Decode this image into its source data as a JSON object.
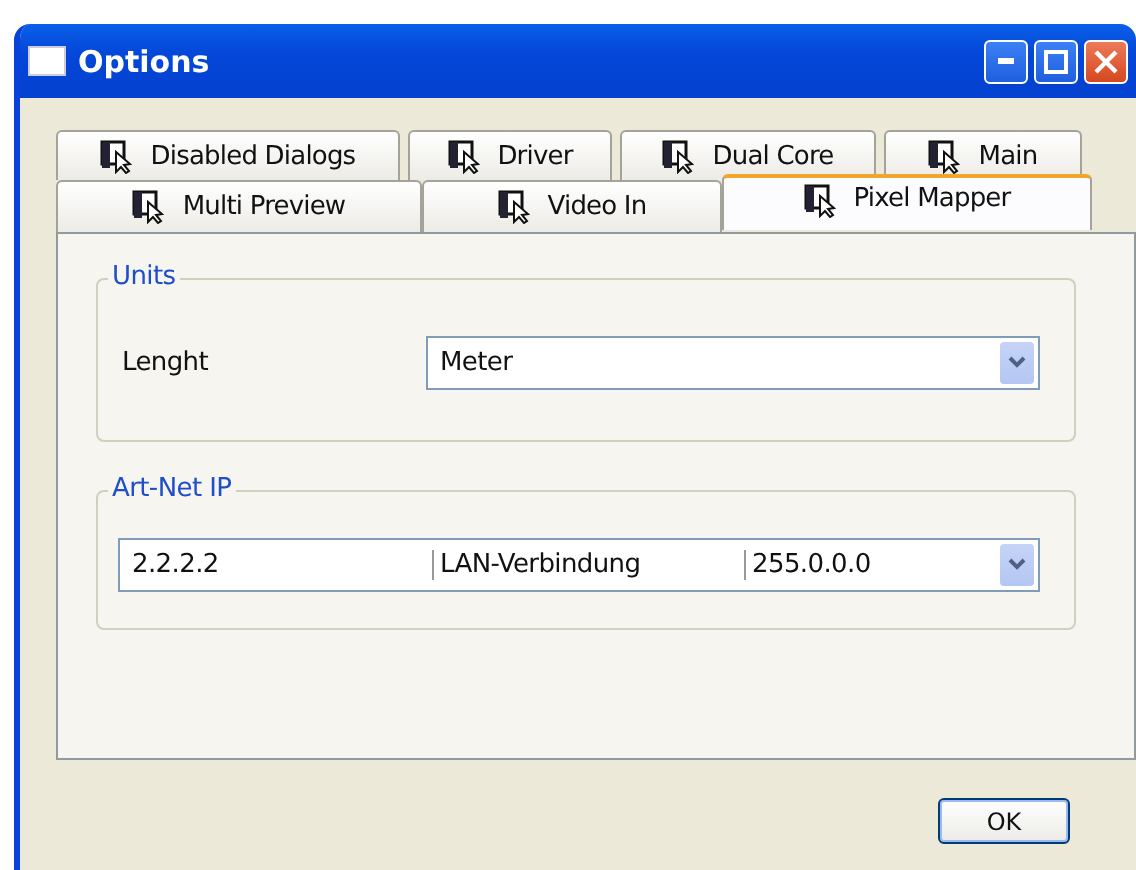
{
  "window": {
    "title": "Options"
  },
  "tabs": {
    "rows": [
      [
        {
          "label": "Disabled Dialogs",
          "selected": false
        },
        {
          "label": "Driver",
          "selected": false
        },
        {
          "label": "Dual Core",
          "selected": false
        },
        {
          "label": "Main",
          "selected": false
        }
      ],
      [
        {
          "label": "Multi Preview",
          "selected": false
        },
        {
          "label": "Video In",
          "selected": false
        },
        {
          "label": "Pixel Mapper",
          "selected": true
        }
      ]
    ]
  },
  "groups": [
    {
      "title": "Units",
      "kind": "field",
      "label": "Lenght",
      "value": "Meter"
    },
    {
      "title": "Art-Net IP",
      "kind": "multi",
      "cells": [
        "2.2.2.2",
        "LAN-Verbindung",
        "255.0.0.0"
      ]
    }
  ],
  "buttons": [
    {
      "label": "OK"
    }
  ]
}
